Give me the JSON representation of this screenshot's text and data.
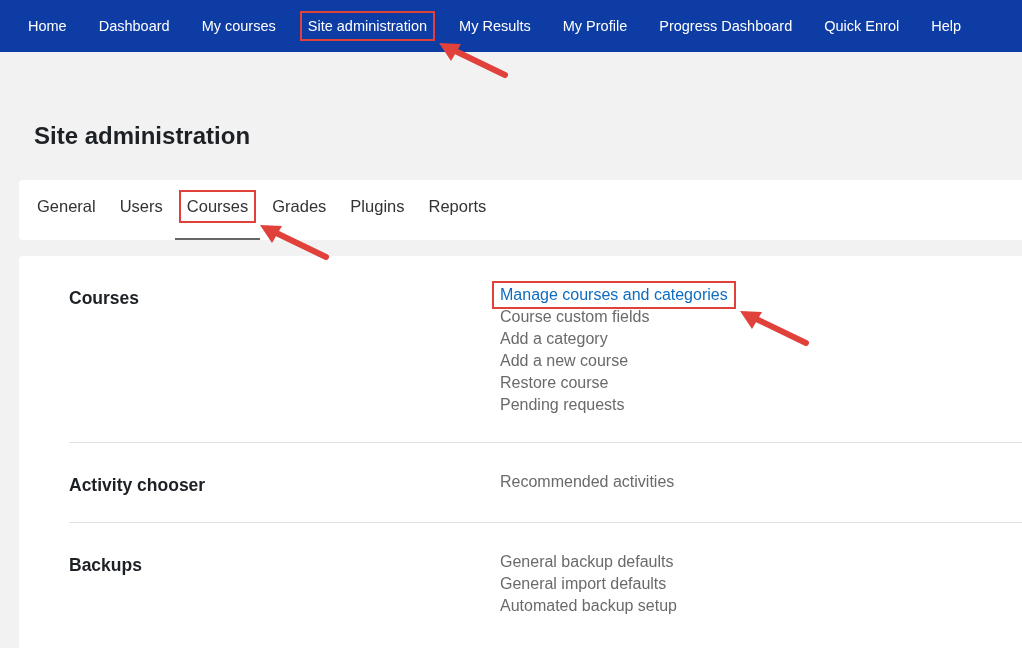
{
  "nav": [
    {
      "label": "Home",
      "highlighted": false
    },
    {
      "label": "Dashboard",
      "highlighted": false
    },
    {
      "label": "My courses",
      "highlighted": false
    },
    {
      "label": "Site administration",
      "highlighted": true
    },
    {
      "label": "My Results",
      "highlighted": false
    },
    {
      "label": "My Profile",
      "highlighted": false
    },
    {
      "label": "Progress Dashboard",
      "highlighted": false
    },
    {
      "label": "Quick Enrol",
      "highlighted": false
    },
    {
      "label": "Help",
      "highlighted": false
    }
  ],
  "page_title": "Site administration",
  "tabs": [
    {
      "label": "General",
      "selected": false,
      "highlighted": false
    },
    {
      "label": "Users",
      "selected": false,
      "highlighted": false
    },
    {
      "label": "Courses",
      "selected": true,
      "highlighted": true
    },
    {
      "label": "Grades",
      "selected": false,
      "highlighted": false
    },
    {
      "label": "Plugins",
      "selected": false,
      "highlighted": false
    },
    {
      "label": "Reports",
      "selected": false,
      "highlighted": false
    }
  ],
  "sections": [
    {
      "heading": "Courses",
      "links": [
        {
          "label": "Manage courses and categories",
          "highlighted": true
        },
        {
          "label": "Course custom fields",
          "highlighted": false
        },
        {
          "label": "Add a category",
          "highlighted": false
        },
        {
          "label": "Add a new course",
          "highlighted": false
        },
        {
          "label": "Restore course",
          "highlighted": false
        },
        {
          "label": "Pending requests",
          "highlighted": false
        }
      ]
    },
    {
      "heading": "Activity chooser",
      "links": [
        {
          "label": "Recommended activities",
          "highlighted": false
        }
      ]
    },
    {
      "heading": "Backups",
      "links": [
        {
          "label": "General backup defaults",
          "highlighted": false
        },
        {
          "label": "General import defaults",
          "highlighted": false
        },
        {
          "label": "Automated backup setup",
          "highlighted": false
        }
      ]
    }
  ]
}
